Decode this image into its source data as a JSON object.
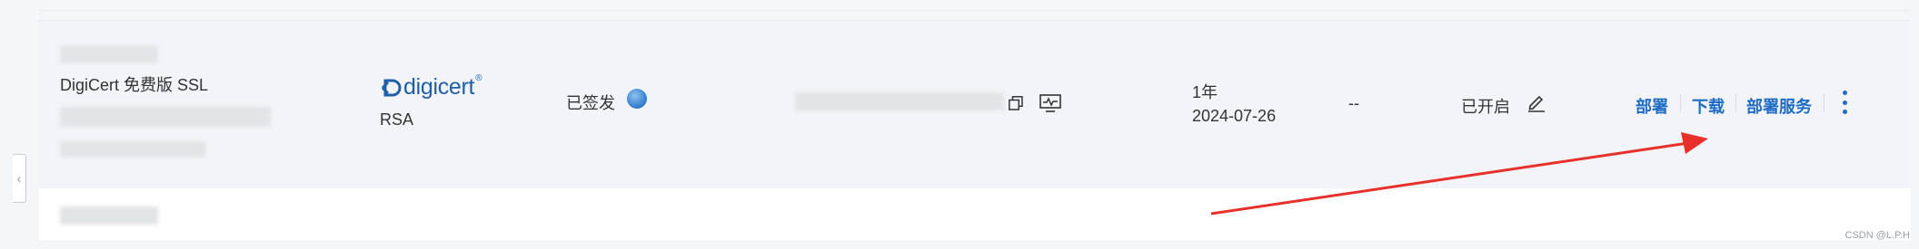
{
  "row": {
    "cert_name": "DigiCert 免费版 SSL",
    "brand_logo_text": "digicert",
    "algorithm": "RSA",
    "status": "已签发",
    "validity_period": "1年",
    "expiry_date": "2024-07-26",
    "extra_value": "--",
    "auto_renew_status": "已开启",
    "actions": {
      "deploy": "部署",
      "download": "下载",
      "deploy_service": "部署服务"
    }
  },
  "watermark": "CSDN @L.P.H",
  "colors": {
    "accent": "#1d6bc4",
    "brand": "#1f5fa8",
    "arrow": "#e8302b"
  }
}
